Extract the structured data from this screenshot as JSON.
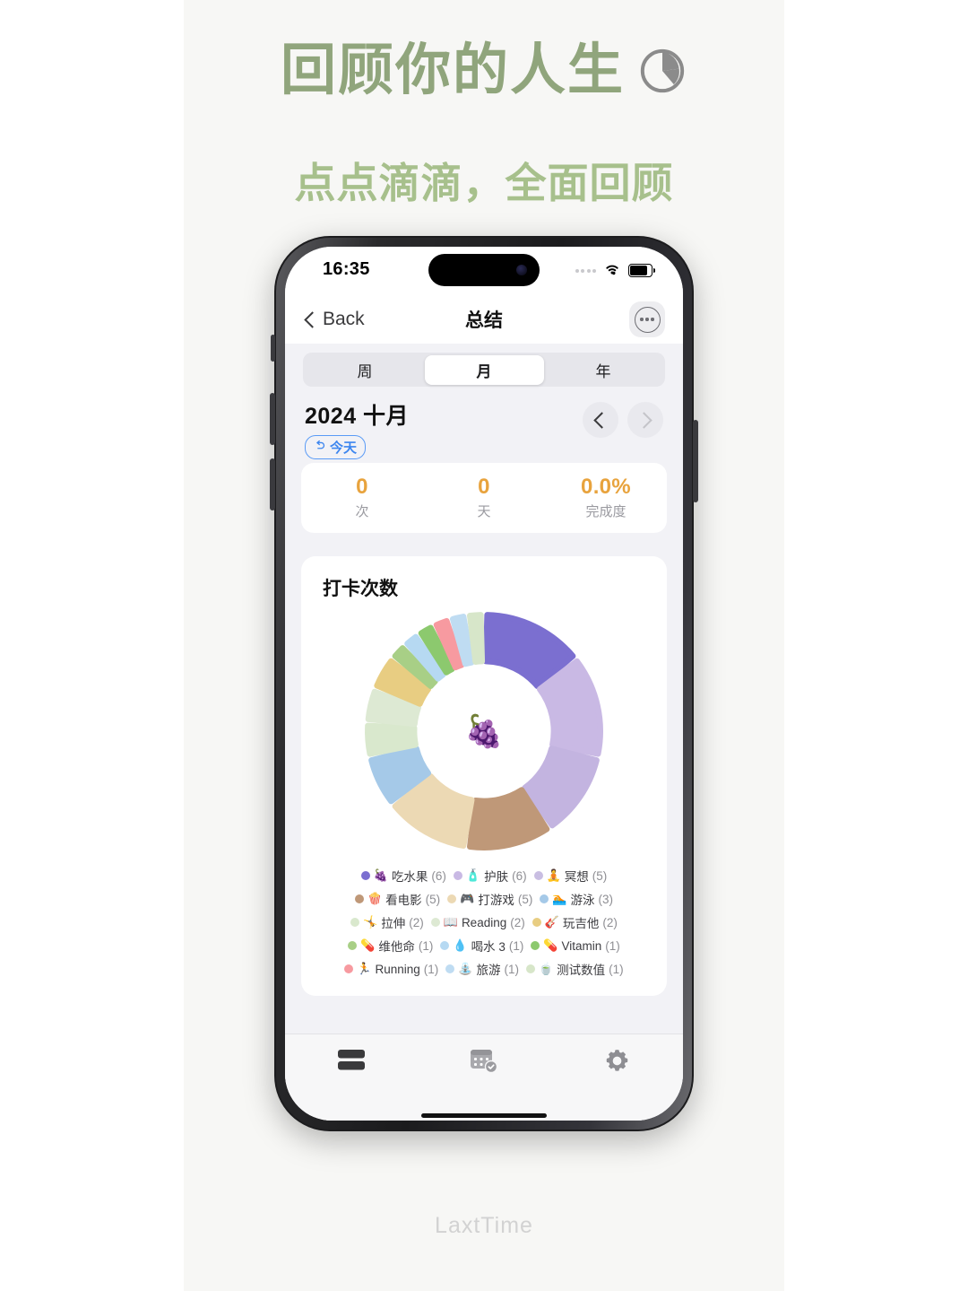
{
  "promo": {
    "headline": "回顾你的人生",
    "headline_icon": "pie-chart-icon",
    "subheadline": "点点滴滴，全面回顾",
    "brand": "LaxtTime",
    "headline_color": "#90a57c",
    "subheadline_color": "#a7c08c"
  },
  "status_bar": {
    "time": "16:35",
    "wifi_icon": "wifi-icon",
    "battery_icon": "battery-icon"
  },
  "nav": {
    "back_label": "Back",
    "title": "总结",
    "more_icon": "ellipsis-circle-icon"
  },
  "segmented": {
    "options": [
      {
        "label": "周",
        "selected": false
      },
      {
        "label": "月",
        "selected": true
      },
      {
        "label": "年",
        "selected": false
      }
    ]
  },
  "date_row": {
    "title": "2024 十月",
    "today_button": "今天",
    "today_icon": "undo-arrow-icon",
    "prev_icon": "chevron-left-icon",
    "next_icon": "chevron-right-icon"
  },
  "stats": [
    {
      "value": "0",
      "label": "次"
    },
    {
      "value": "0",
      "label": "天"
    },
    {
      "value": "0.0%",
      "label": "完成度"
    }
  ],
  "stats_color": "#e8a33d",
  "chart_card": {
    "title": "打卡次数",
    "center_emoji": "🍇"
  },
  "chart_data": {
    "type": "pie",
    "title": "打卡次数",
    "legend_position": "bottom",
    "slices": [
      {
        "label": "吃水果",
        "emoji": "🍇",
        "value": 6,
        "color": "#7b6fd0"
      },
      {
        "label": "护肤",
        "emoji": "🧴",
        "value": 6,
        "color": "#c9b9e4"
      },
      {
        "label": "冥想",
        "emoji": "🧘",
        "value": 5,
        "color": "#c3b4e0"
      },
      {
        "label": "看电影",
        "emoji": "🍿",
        "value": 5,
        "color": "#bf9878"
      },
      {
        "label": "打游戏",
        "emoji": "🎮",
        "value": 5,
        "color": "#ecd9b4"
      },
      {
        "label": "游泳",
        "emoji": "🏊",
        "value": 3,
        "color": "#a5c9e8"
      },
      {
        "label": "拉伸",
        "emoji": "🤸",
        "value": 2,
        "color": "#d9e8cd"
      },
      {
        "label": "Reading",
        "emoji": "📖",
        "value": 2,
        "color": "#dde9d3"
      },
      {
        "label": "玩吉他",
        "emoji": "🎸",
        "value": 2,
        "color": "#e8cd82"
      },
      {
        "label": "维他命",
        "emoji": "💊",
        "value": 1,
        "color": "#a8cf86"
      },
      {
        "label": "喝水 3",
        "emoji": "💧",
        "value": 1,
        "color": "#b6d9f2"
      },
      {
        "label": "Vitamin",
        "emoji": "💊",
        "value": 1,
        "color": "#8cc96e"
      },
      {
        "label": "Running",
        "emoji": "🏃",
        "value": 1,
        "color": "#f79aa0"
      },
      {
        "label": "旅游",
        "emoji": "⛲",
        "value": 1,
        "color": "#bfdcf2"
      },
      {
        "label": "测试数值",
        "emoji": "🍵",
        "value": 1,
        "color": "#d7e6c9"
      }
    ]
  },
  "legend_rows": [
    [
      {
        "label": "吃水果",
        "emoji": "🍇",
        "count": "(6)",
        "color": "#7b6fd0"
      },
      {
        "label": "护肤",
        "emoji": "🧴",
        "count": "(6)",
        "color": "#c9b9e4"
      },
      {
        "label": "冥想",
        "emoji": "🧘",
        "count": "(5)",
        "color": "#c9bee2"
      }
    ],
    [
      {
        "label": "看电影",
        "emoji": "🍿",
        "count": "(5)",
        "color": "#bf9878"
      },
      {
        "label": "打游戏",
        "emoji": "🎮",
        "count": "(5)",
        "color": "#ecd9b4"
      },
      {
        "label": "游泳",
        "emoji": "🏊",
        "count": "(3)",
        "color": "#a5c9e8"
      }
    ],
    [
      {
        "label": "拉伸",
        "emoji": "🤸",
        "count": "(2)",
        "color": "#d9e8cd"
      },
      {
        "label": "Reading",
        "emoji": "📖",
        "count": "(2)",
        "color": "#dde9d3"
      },
      {
        "label": "玩吉他",
        "emoji": "🎸",
        "count": "(2)",
        "color": "#e8cd82"
      }
    ],
    [
      {
        "label": "维他命",
        "emoji": "💊",
        "count": "(1)",
        "color": "#a8cf86"
      },
      {
        "label": "喝水 3",
        "emoji": "💧",
        "count": "(1)",
        "color": "#b6d9f2"
      },
      {
        "label": "Vitamin",
        "emoji": "💊",
        "count": "(1)",
        "color": "#8cc96e"
      }
    ],
    [
      {
        "label": "Running",
        "emoji": "🏃",
        "count": "(1)",
        "color": "#f79aa0"
      },
      {
        "label": "旅游",
        "emoji": "⛲",
        "count": "(1)",
        "color": "#bfdcf2"
      },
      {
        "label": "测试数值",
        "emoji": "🍵",
        "count": "(1)",
        "color": "#d7e6c9"
      }
    ]
  ],
  "tabbar": [
    {
      "icon": "list-icon",
      "active": true
    },
    {
      "icon": "calendar-check-icon",
      "active": false
    },
    {
      "icon": "gear-icon",
      "active": false
    }
  ]
}
